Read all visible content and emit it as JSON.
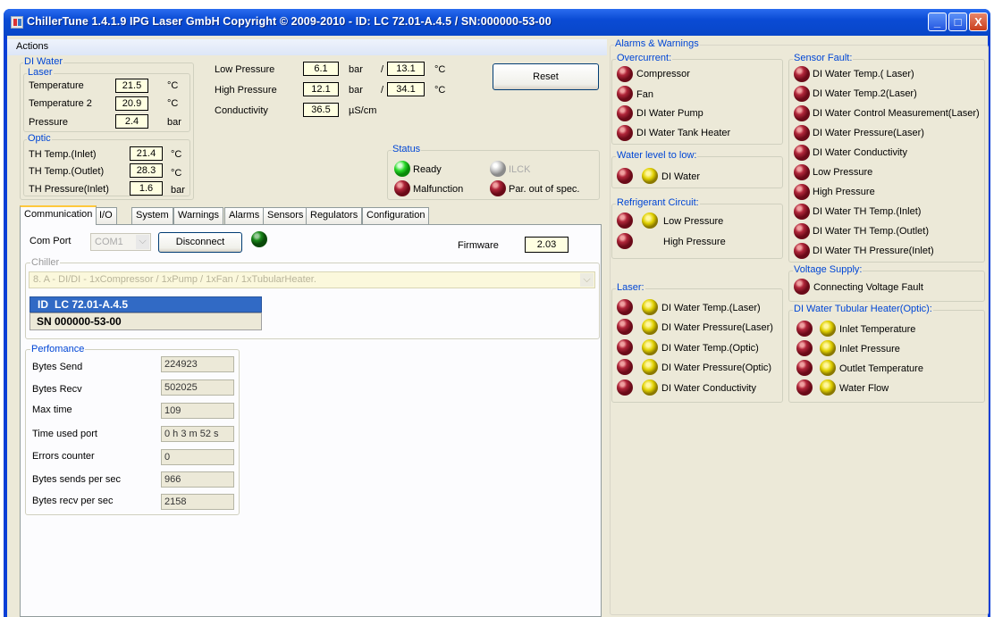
{
  "window": {
    "title": "ChillerTune 1.4.1.9 IPG Laser GmbH Copyright © 2009-2010 - ID: LC 72.01-A.4.5 / SN:000000-53-00",
    "minimize": "_",
    "maximize": "□",
    "close": "X"
  },
  "menu": {
    "actions": "Actions"
  },
  "di_water": {
    "label": "DI Water",
    "laser": {
      "label": "Laser",
      "rows": [
        {
          "name": "Temperature",
          "value": "21.5",
          "unit": "°C"
        },
        {
          "name": "Temperature 2",
          "value": "20.9",
          "unit": "°C"
        },
        {
          "name": "Pressure",
          "value": "2.4",
          "unit": "bar"
        }
      ]
    },
    "optic": {
      "label": "Optic",
      "rows": [
        {
          "name": "TH Temp.(Inlet)",
          "value": "21.4",
          "unit": "°C"
        },
        {
          "name": "TH Temp.(Outlet)",
          "value": "28.3",
          "unit": "°C"
        },
        {
          "name": "TH Pressure(Inlet)",
          "value": "1.6",
          "unit": "bar"
        }
      ]
    }
  },
  "refrigerant": {
    "low": {
      "name": "Low Pressure",
      "value": "6.1",
      "unit": "bar",
      "sep": "/",
      "temp": "13.1",
      "temp_unit": "°C"
    },
    "high": {
      "name": "High Pressure",
      "value": "12.1",
      "unit": "bar",
      "sep": "/",
      "temp": "34.1",
      "temp_unit": "°C"
    },
    "cond": {
      "name": "Conductivity",
      "value": "36.5",
      "unit": "µS/cm"
    }
  },
  "reset": "Reset",
  "status": {
    "label": "Status",
    "ready": "Ready",
    "ilck": "ILCK",
    "malfunction": "Malfunction",
    "par_out": "Par. out of spec."
  },
  "tabs": [
    "Communication",
    "I/O",
    "System",
    "Warnings",
    "Alarms",
    "Sensors",
    "Regulators",
    "Configuration"
  ],
  "comm": {
    "com_port_label": "Com Port",
    "com_port_value": "COM1",
    "disconnect": "Disconnect",
    "firmware_label": "Firmware",
    "firmware_value": "2.03",
    "chiller_label": "Chiller",
    "chiller_value": "8.   A - DI/DI - 1xCompressor / 1xPump / 1xFan / 1xTubularHeater.",
    "id_label": "ID",
    "id_value": "LC 72.01-A.4.5",
    "sn_label": "SN",
    "sn_value": "000000-53-00"
  },
  "perf": {
    "label": "Perfomance",
    "rows": [
      {
        "name": "Bytes Send",
        "value": "224923"
      },
      {
        "name": "Bytes Recv",
        "value": "502025"
      },
      {
        "name": "Max time",
        "value": "109"
      },
      {
        "name": "Time used port",
        "value": "0 h 3 m 52 s"
      },
      {
        "name": "Errors counter",
        "value": "0"
      },
      {
        "name": "Bytes sends per sec",
        "value": "966"
      },
      {
        "name": "Bytes recv per sec",
        "value": "2158"
      }
    ]
  },
  "alarms": {
    "label": "Alarms & Warnings",
    "overcurrent": {
      "label": "Overcurrent:",
      "items": [
        "Compressor",
        "Fan",
        "DI Water Pump",
        "DI Water Tank Heater"
      ]
    },
    "water_level": {
      "label": "Water level to low:",
      "items": [
        "DI Water"
      ]
    },
    "refrigerant": {
      "label": "Refrigerant Circuit:",
      "items": [
        "Low Pressure",
        "High Pressure"
      ]
    },
    "laser": {
      "label": "Laser:",
      "items": [
        "DI Water Temp.(Laser)",
        "DI Water Pressure(Laser)",
        "DI Water Temp.(Optic)",
        "DI Water Pressure(Optic)",
        "DI Water Conductivity"
      ]
    },
    "sensor": {
      "label": "Sensor Fault:",
      "items": [
        "DI Water Temp.( Laser)",
        "DI Water Temp.2(Laser)",
        "DI Water Control Measurement(Laser)",
        "DI Water Pressure(Laser)",
        "DI Water Conductivity",
        "Low Pressure",
        "High Pressure",
        "DI Water TH Temp.(Inlet)",
        "DI Water TH Temp.(Outlet)",
        "DI Water TH Pressure(Inlet)"
      ]
    },
    "voltage": {
      "label": "Voltage Supply:",
      "items": [
        "Connecting Voltage Fault"
      ]
    },
    "tubular": {
      "label": "DI Water Tubular Heater(Optic):",
      "items": [
        "Inlet Temperature",
        "Inlet Pressure",
        "Outlet Temperature",
        "Water Flow"
      ]
    }
  }
}
